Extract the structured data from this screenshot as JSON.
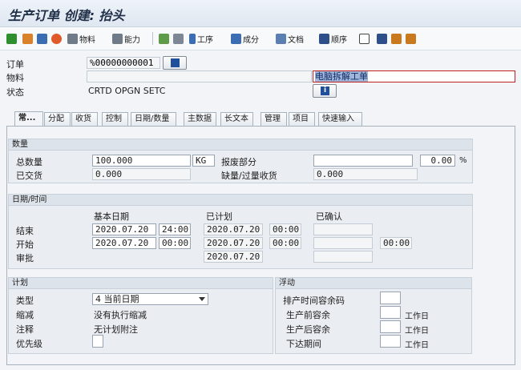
{
  "window": {
    "title": "生产订单 创建: 抬头"
  },
  "toolbar": {
    "material_label": "物料",
    "capacity_label": "能力",
    "operation_label": "工序",
    "component_label": "成分",
    "document_label": "文档",
    "sequence_label": "顺序"
  },
  "header": {
    "order_label": "订单",
    "order_value": "%00000000001",
    "material_label": "物料",
    "material_value": "",
    "material_desc": "电脑拆解工单",
    "status_label": "状态",
    "status_value": "CRTD OPGN SETC"
  },
  "tabs": [
    {
      "label": "常..."
    },
    {
      "label": "分配"
    },
    {
      "label": "收货"
    },
    {
      "label": "控制"
    },
    {
      "label": "日期/数量"
    },
    {
      "label": "主数据"
    },
    {
      "label": "长文本"
    },
    {
      "label": "管理"
    },
    {
      "label": "项目"
    },
    {
      "label": "快速输入"
    }
  ],
  "quantity": {
    "group_title": "数量",
    "total_label": "总数量",
    "total_value": "100.000",
    "unit": "KG",
    "scrap_label": "报废部分",
    "scrap_value": "",
    "scrap_percent": "0.00",
    "percent_sign": "%",
    "delivered_label": "已交货",
    "delivered_value": "0.000",
    "short_label": "缺量/过量收货",
    "short_value": "0.000"
  },
  "dates": {
    "group_title": "日期/时间",
    "col_basic": "基本日期",
    "col_scheduled": "已计划",
    "col_confirmed": "已确认",
    "finish_label": "结束",
    "finish_basic_date": "2020.07.20",
    "finish_basic_time": "24:00",
    "finish_sched_date": "2020.07.20",
    "finish_sched_time": "00:00",
    "start_label": "开始",
    "start_basic_date": "2020.07.20",
    "start_basic_time": "00:00",
    "start_sched_date": "2020.07.20",
    "start_sched_time": "00:00",
    "start_conf_time": "00:00",
    "release_label": "审批",
    "release_sched_date": "2020.07.20"
  },
  "planning": {
    "group_title": "计划",
    "type_label": "类型",
    "type_value": "4 当前日期",
    "reduction_label": "缩减",
    "reduction_value": "没有执行缩减",
    "note_label": "注释",
    "note_value": "无计划附注",
    "priority_label": "优先级"
  },
  "float": {
    "group_title": "浮动",
    "sched_margin_label": "排产时间容余码",
    "before_label": "生产前容余",
    "after_label": "生产后容余",
    "release_period_label": "下达期间",
    "unit_label": "工作日"
  },
  "colors": {
    "accent": "#1f4e9a",
    "highlight": "#9fb5da"
  }
}
